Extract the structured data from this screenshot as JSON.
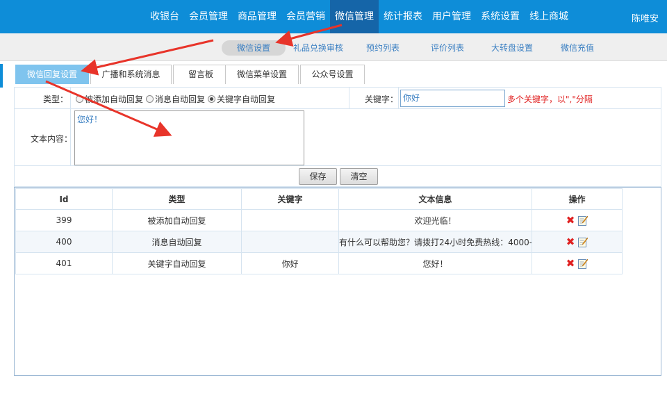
{
  "topnav": {
    "items": [
      {
        "label": "收银台",
        "active": false
      },
      {
        "label": "会员管理",
        "active": false
      },
      {
        "label": "商品管理",
        "active": false
      },
      {
        "label": "会员营销",
        "active": false
      },
      {
        "label": "微信管理",
        "active": true
      },
      {
        "label": "统计报表",
        "active": false
      },
      {
        "label": "用户管理",
        "active": false
      },
      {
        "label": "系统设置",
        "active": false
      },
      {
        "label": "线上商城",
        "active": false
      }
    ],
    "user": "陈唯安"
  },
  "subnav": {
    "items": [
      {
        "label": "微信设置",
        "active": true
      },
      {
        "label": "礼品兑换审核",
        "active": false
      },
      {
        "label": "预约列表",
        "active": false
      },
      {
        "label": "评价列表",
        "active": false
      },
      {
        "label": "大转盘设置",
        "active": false
      },
      {
        "label": "微信充值",
        "active": false
      }
    ]
  },
  "tabs": [
    {
      "label": "微信回复设置",
      "active": true
    },
    {
      "label": "广播和系统消息",
      "active": false
    },
    {
      "label": "留言板",
      "active": false
    },
    {
      "label": "微信菜单设置",
      "active": false
    },
    {
      "label": "公众号设置",
      "active": false
    }
  ],
  "form": {
    "type_label": "类型：",
    "type_options": [
      {
        "label": "被添加自动回复",
        "checked": false
      },
      {
        "label": "消息自动回复",
        "checked": false
      },
      {
        "label": "关键字自动回复",
        "checked": true
      }
    ],
    "keyword_label": "关键字：",
    "keyword_value": "你好",
    "keyword_hint": "多个关键字，以\",\"分隔",
    "content_label": "文本内容：",
    "content_value": "您好！",
    "save_label": "保存",
    "clear_label": "清空"
  },
  "table": {
    "headers": [
      "Id",
      "类型",
      "关键字",
      "文本信息",
      "操作"
    ],
    "rows": [
      {
        "id": "399",
        "type": "被添加自动回复",
        "keyword": "",
        "text": "欢迎光临！"
      },
      {
        "id": "400",
        "type": "消息自动回复",
        "keyword": "",
        "text": "有什么可以帮助您？请拨打24小时免费热线：4000-"
      },
      {
        "id": "401",
        "type": "关键字自动回复",
        "keyword": "你好",
        "text": "您好！"
      }
    ]
  },
  "colors": {
    "header_bg": "#0e8dd8",
    "header_active": "#1565a8",
    "tab_active": "#7fc4ee",
    "arrow": "#e8342a",
    "hint": "#e02020"
  }
}
